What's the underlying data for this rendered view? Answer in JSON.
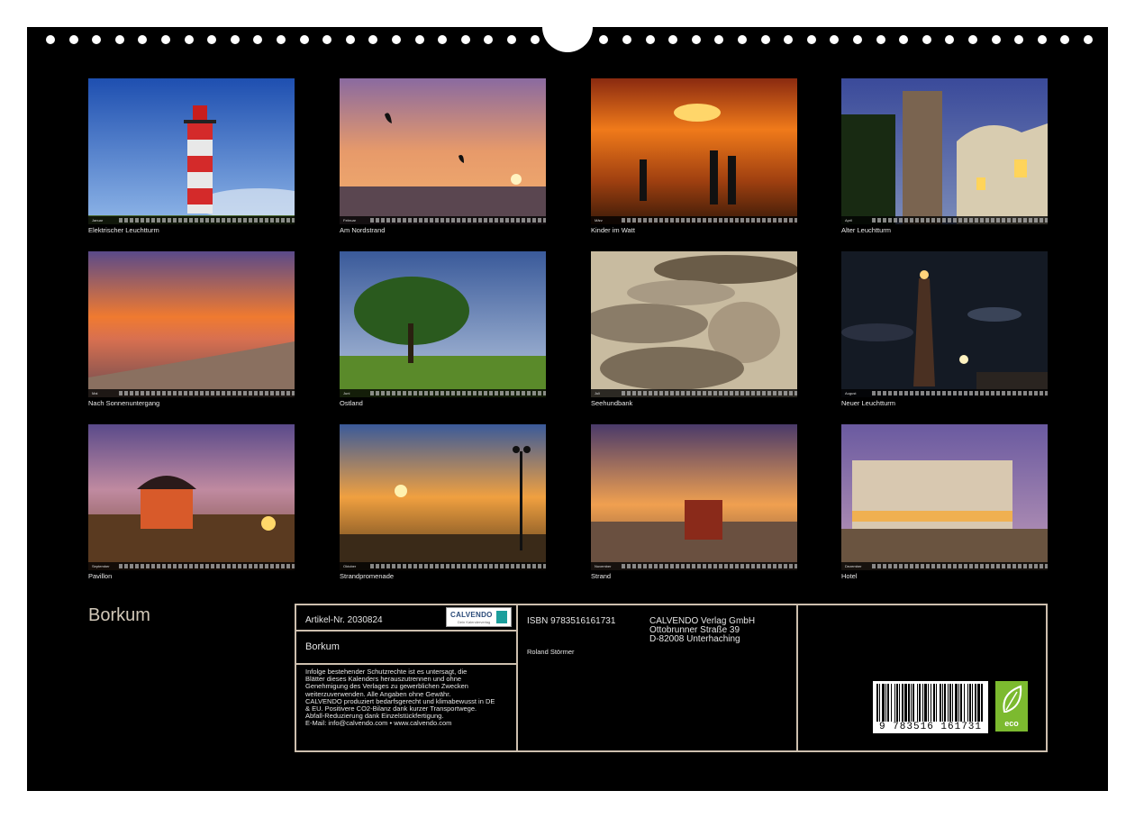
{
  "calendar": {
    "title": "Borkum",
    "months": [
      {
        "month": "Januar",
        "caption": "Elektrischer Leuchtturm"
      },
      {
        "month": "Februar",
        "caption": "Am Nordstrand"
      },
      {
        "month": "März",
        "caption": "Kinder im Watt"
      },
      {
        "month": "April",
        "caption": "Alter Leuchtturm"
      },
      {
        "month": "Mai",
        "caption": "Nach Sonnenuntergang"
      },
      {
        "month": "Juni",
        "caption": "Ostland"
      },
      {
        "month": "Juli",
        "caption": "Seehundbank"
      },
      {
        "month": "August",
        "caption": "Neuer Leuchtturm"
      },
      {
        "month": "September",
        "caption": "Pavillon"
      },
      {
        "month": "Oktober",
        "caption": "Strandpromenade"
      },
      {
        "month": "November",
        "caption": "Strand"
      },
      {
        "month": "Dezember",
        "caption": "Hotel"
      }
    ]
  },
  "info": {
    "article": "Artikel-Nr. 2030824",
    "logo_word": "CALVENDO",
    "logo_tag": "Dein Kalenderverlag",
    "product_title": "Borkum",
    "legal_lines": [
      "Infolge bestehender Schutzrechte ist es untersagt, die",
      "Blätter dieses Kalenders herauszutrennen und ohne",
      "Genehmigung des Verlages zu gewerblichen Zwecken",
      "weiterzuverwenden. Alle Angaben ohne Gewähr.",
      "CALVENDO produziert bedarfsgerecht und klimabewusst in DE",
      "& EU. Positivere CO2-Bilanz dank kurzer Transportwege.",
      "Abfall-Reduzierung dank Einzelstückfertigung.",
      "E-Mail: info@calvendo.com • www.calvendo.com"
    ],
    "isbn": "ISBN 9783516161731",
    "author": "Roland Störmer",
    "publisher_lines": [
      "CALVENDO Verlag GmbH",
      "Ottobrunner Straße 39",
      "D-82008 Unterhaching"
    ],
    "barcode_number": "9 783516 161731",
    "eco_label": "eco"
  },
  "colors": {
    "sheet": "#000000",
    "frame": "#cdbfae",
    "title": "#d2c8b8",
    "eco": "#7cba2f"
  }
}
